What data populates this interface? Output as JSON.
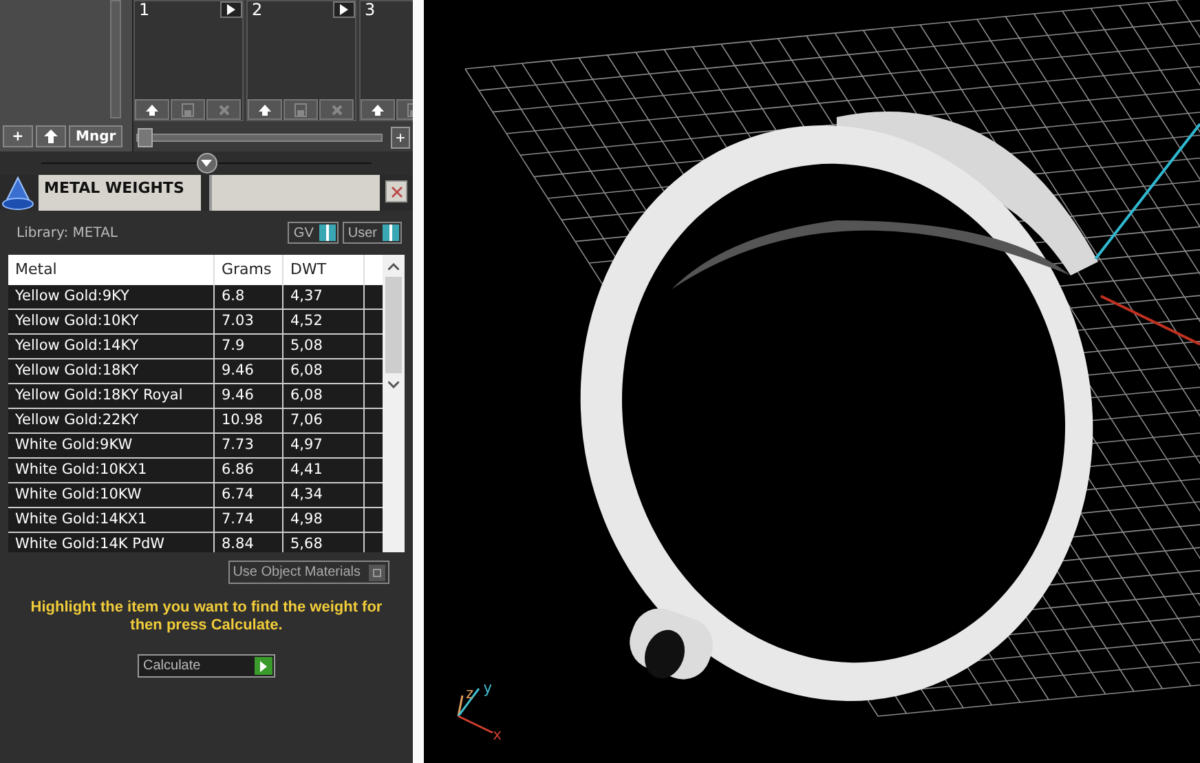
{
  "slots_panel": {
    "slots": [
      {
        "label": "1"
      },
      {
        "label": "2"
      },
      {
        "label": "3"
      }
    ],
    "buttons": [
      {
        "kind": "text",
        "label": "+"
      },
      {
        "kind": "icon"
      },
      {
        "kind": "text",
        "label": "Mngr"
      }
    ],
    "zoom_button": "+",
    "slider": {
      "level": 0
    }
  },
  "metal_weights": {
    "title": "METAL WEIGHTS",
    "library": "Library: METAL",
    "toggles": [
      {
        "label": "GV",
        "on": true
      },
      {
        "label": "User",
        "on": true
      }
    ],
    "table": {
      "columns": [
        "Metal",
        "Grams",
        "DWT"
      ],
      "rows": [
        {
          "metal": "Yellow Gold:9KY",
          "grams": "6.8",
          "dwt": "4,37"
        },
        {
          "metal": "Yellow Gold:10KY",
          "grams": "7.03",
          "dwt": "4,52"
        },
        {
          "metal": "Yellow Gold:14KY",
          "grams": "7.9",
          "dwt": "5,08"
        },
        {
          "metal": "Yellow Gold:18KY",
          "grams": "9.46",
          "dwt": "6,08"
        },
        {
          "metal": "Yellow Gold:18KY Royal",
          "grams": "9.46",
          "dwt": "6,08"
        },
        {
          "metal": "Yellow Gold:22KY",
          "grams": "10.98",
          "dwt": "7,06"
        },
        {
          "metal": "White Gold:9KW",
          "grams": "7.73",
          "dwt": "4,97"
        },
        {
          "metal": "White Gold:10KX1",
          "grams": "6.86",
          "dwt": "4,41"
        },
        {
          "metal": "White Gold:10KW",
          "grams": "6.74",
          "dwt": "4,34"
        },
        {
          "metal": "White Gold:14KX1",
          "grams": "7.74",
          "dwt": "4,98"
        },
        {
          "metal": "White Gold:14K PdW",
          "grams": "8.84",
          "dwt": "5,68"
        }
      ]
    },
    "use_object_materials": {
      "label": "Use Object Materials",
      "on": false
    },
    "hint": "Highlight the item you want to find the weight for then press Calculate.",
    "calculate_button": "Calculate"
  },
  "viewport": {
    "axes": [
      {
        "label": "z",
        "color": "#e0a060"
      },
      {
        "label": "y",
        "color": "#40c0d0"
      },
      {
        "label": "x",
        "color": "#d04030"
      }
    ]
  }
}
